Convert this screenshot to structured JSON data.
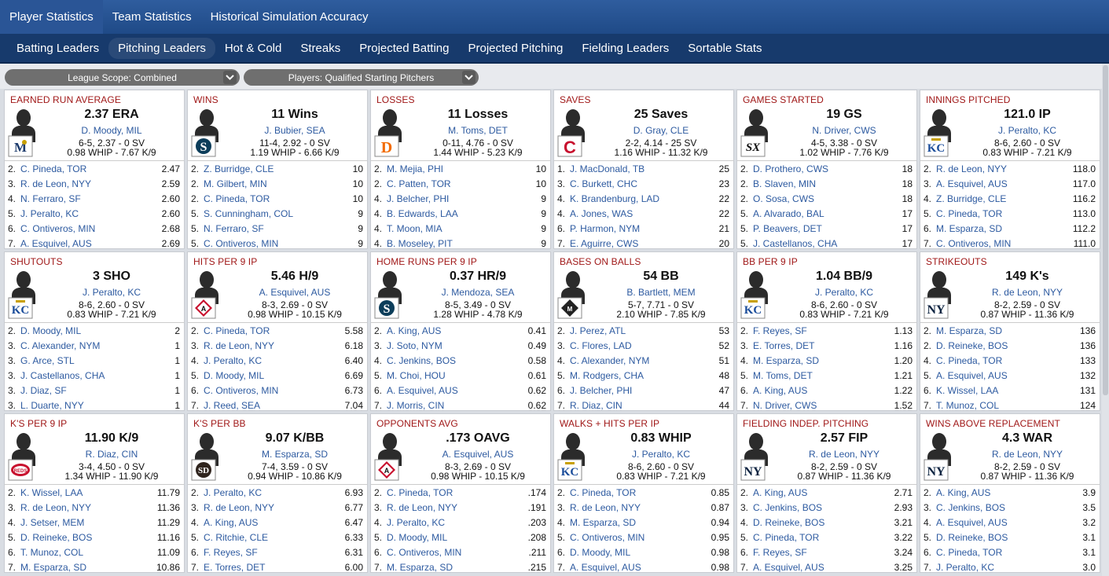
{
  "top_tabs": [
    {
      "label": "Player Statistics",
      "active": true
    },
    {
      "label": "Team Statistics",
      "active": false
    },
    {
      "label": "Historical Simulation Accuracy",
      "active": false
    }
  ],
  "sub_tabs": [
    {
      "label": "Batting Leaders",
      "active": false
    },
    {
      "label": "Pitching Leaders",
      "active": true
    },
    {
      "label": "Hot & Cold",
      "active": false
    },
    {
      "label": "Streaks",
      "active": false
    },
    {
      "label": "Projected Batting",
      "active": false
    },
    {
      "label": "Projected Pitching",
      "active": false
    },
    {
      "label": "Fielding Leaders",
      "active": false
    },
    {
      "label": "Sortable Stats",
      "active": false
    }
  ],
  "filters": {
    "scope": "League Scope: Combined",
    "players": "Players: Qualified Starting Pitchers"
  },
  "cards": [
    {
      "title": "EARNED RUN AVERAGE",
      "value": "2.37 ERA",
      "player": "D. Moody, MIL",
      "line1": "6-5, 2.37 - 0 SV",
      "line2": "0.98 WHIP - 7.67 K/9",
      "logo": "brewers-logo",
      "leaders": [
        [
          "2.",
          "C. Pineda, TOR",
          "2.47"
        ],
        [
          "3.",
          "R. de Leon, NYY",
          "2.59"
        ],
        [
          "4.",
          "N. Ferraro, SF",
          "2.60"
        ],
        [
          "5.",
          "J. Peralto, KC",
          "2.60"
        ],
        [
          "6.",
          "C. Ontiveros, MIN",
          "2.68"
        ],
        [
          "7.",
          "A. Esquivel, AUS",
          "2.69"
        ]
      ]
    },
    {
      "title": "WINS",
      "value": "11 Wins",
      "player": "J. Bubier, SEA",
      "line1": "11-4, 2.92 - 0 SV",
      "line2": "1.19 WHIP - 6.66 K/9",
      "logo": "mariners-logo",
      "leaders": [
        [
          "2.",
          "Z. Burridge, CLE",
          "10"
        ],
        [
          "2.",
          "M. Gilbert, MIN",
          "10"
        ],
        [
          "2.",
          "C. Pineda, TOR",
          "10"
        ],
        [
          "5.",
          "S. Cunningham, COL",
          "9"
        ],
        [
          "5.",
          "N. Ferraro, SF",
          "9"
        ],
        [
          "5.",
          "C. Ontiveros, MIN",
          "9"
        ]
      ]
    },
    {
      "title": "LOSSES",
      "value": "11 Losses",
      "player": "M. Toms, DET",
      "line1": "0-11, 4.76 - 0 SV",
      "line2": "1.44 WHIP - 5.23 K/9",
      "logo": "tigers-logo",
      "leaders": [
        [
          "2.",
          "M. Mejia, PHI",
          "10"
        ],
        [
          "2.",
          "C. Patten, TOR",
          "10"
        ],
        [
          "4.",
          "J. Belcher, PHI",
          "9"
        ],
        [
          "4.",
          "B. Edwards, LAA",
          "9"
        ],
        [
          "4.",
          "T. Moon, MIA",
          "9"
        ],
        [
          "4.",
          "B. Moseley, PIT",
          "9"
        ]
      ]
    },
    {
      "title": "SAVES",
      "value": "25 Saves",
      "player": "D. Gray, CLE",
      "line1": "2-2, 4.14 - 25 SV",
      "line2": "1.16 WHIP - 11.32 K/9",
      "logo": "guardians-logo",
      "leaders": [
        [
          "1.",
          "J. MacDonald, TB",
          "25"
        ],
        [
          "3.",
          "C. Burkett, CHC",
          "23"
        ],
        [
          "4.",
          "K. Brandenburg, LAD",
          "22"
        ],
        [
          "4.",
          "A. Jones, WAS",
          "22"
        ],
        [
          "6.",
          "P. Harmon, NYM",
          "21"
        ],
        [
          "7.",
          "E. Aguirre, CWS",
          "20"
        ]
      ]
    },
    {
      "title": "GAMES STARTED",
      "value": "19 GS",
      "player": "N. Driver, CWS",
      "line1": "4-5, 3.38 - 0 SV",
      "line2": "1.02 WHIP - 7.76 K/9",
      "logo": "whitesox-logo",
      "leaders": [
        [
          "2.",
          "D. Prothero, CWS",
          "18"
        ],
        [
          "2.",
          "B. Slaven, MIN",
          "18"
        ],
        [
          "2.",
          "O. Sosa, CWS",
          "18"
        ],
        [
          "5.",
          "A. Alvarado, BAL",
          "17"
        ],
        [
          "5.",
          "P. Beavers, DET",
          "17"
        ],
        [
          "5.",
          "J. Castellanos, CHA",
          "17"
        ]
      ]
    },
    {
      "title": "INNINGS PITCHED",
      "value": "121.0 IP",
      "player": "J. Peralto, KC",
      "line1": "8-6, 2.60 - 0 SV",
      "line2": "0.83 WHIP - 7.21 K/9",
      "logo": "royals-logo",
      "leaders": [
        [
          "2.",
          "R. de Leon, NYY",
          "118.0"
        ],
        [
          "3.",
          "A. Esquivel, AUS",
          "117.0"
        ],
        [
          "4.",
          "Z. Burridge, CLE",
          "116.2"
        ],
        [
          "5.",
          "C. Pineda, TOR",
          "113.0"
        ],
        [
          "6.",
          "M. Esparza, SD",
          "112.2"
        ],
        [
          "7.",
          "C. Ontiveros, MIN",
          "111.0"
        ]
      ]
    },
    {
      "title": "SHUTOUTS",
      "value": "3 SHO",
      "player": "J. Peralto, KC",
      "line1": "8-6, 2.60 - 0 SV",
      "line2": "0.83 WHIP - 7.21 K/9",
      "logo": "royals-logo",
      "leaders": [
        [
          "2.",
          "D. Moody, MIL",
          "2"
        ],
        [
          "3.",
          "C. Alexander, NYM",
          "1"
        ],
        [
          "3.",
          "G. Arce, STL",
          "1"
        ],
        [
          "3.",
          "J. Castellanos, CHA",
          "1"
        ],
        [
          "3.",
          "J. Diaz, SF",
          "1"
        ],
        [
          "3.",
          "L. Duarte, NYY",
          "1"
        ]
      ]
    },
    {
      "title": "HITS PER 9 IP",
      "value": "5.46 H/9",
      "player": "A. Esquivel, AUS",
      "line1": "8-3, 2.69 - 0 SV",
      "line2": "0.98 WHIP - 10.15 K/9",
      "logo": "aus-logo",
      "leaders": [
        [
          "2.",
          "C. Pineda, TOR",
          "5.58"
        ],
        [
          "3.",
          "R. de Leon, NYY",
          "6.18"
        ],
        [
          "4.",
          "J. Peralto, KC",
          "6.40"
        ],
        [
          "5.",
          "D. Moody, MIL",
          "6.69"
        ],
        [
          "6.",
          "C. Ontiveros, MIN",
          "6.73"
        ],
        [
          "7.",
          "J. Reed, SEA",
          "7.04"
        ]
      ]
    },
    {
      "title": "HOME RUNS PER 9 IP",
      "value": "0.37 HR/9",
      "player": "J. Mendoza, SEA",
      "line1": "8-5, 3.49 - 0 SV",
      "line2": "1.28 WHIP - 4.78 K/9",
      "logo": "mariners-logo",
      "leaders": [
        [
          "2.",
          "A. King, AUS",
          "0.41"
        ],
        [
          "3.",
          "J. Soto, NYM",
          "0.49"
        ],
        [
          "4.",
          "C. Jenkins, BOS",
          "0.58"
        ],
        [
          "5.",
          "M. Choi, HOU",
          "0.61"
        ],
        [
          "6.",
          "A. Esquivel, AUS",
          "0.62"
        ],
        [
          "7.",
          "J. Morris, CIN",
          "0.62"
        ]
      ]
    },
    {
      "title": "BASES ON BALLS",
      "value": "54 BB",
      "player": "B. Bartlett, MEM",
      "line1": "5-7, 7.71 - 0 SV",
      "line2": "2.10 WHIP - 7.85 K/9",
      "logo": "mem-logo",
      "leaders": [
        [
          "2.",
          "J. Perez, ATL",
          "53"
        ],
        [
          "3.",
          "C. Flores, LAD",
          "52"
        ],
        [
          "4.",
          "C. Alexander, NYM",
          "51"
        ],
        [
          "5.",
          "M. Rodgers, CHA",
          "48"
        ],
        [
          "6.",
          "J. Belcher, PHI",
          "47"
        ],
        [
          "7.",
          "R. Diaz, CIN",
          "44"
        ]
      ]
    },
    {
      "title": "BB PER 9 IP",
      "value": "1.04 BB/9",
      "player": "J. Peralto, KC",
      "line1": "8-6, 2.60 - 0 SV",
      "line2": "0.83 WHIP - 7.21 K/9",
      "logo": "royals-logo",
      "leaders": [
        [
          "2.",
          "F. Reyes, SF",
          "1.13"
        ],
        [
          "3.",
          "E. Torres, DET",
          "1.16"
        ],
        [
          "4.",
          "M. Esparza, SD",
          "1.20"
        ],
        [
          "5.",
          "M. Toms, DET",
          "1.21"
        ],
        [
          "6.",
          "A. King, AUS",
          "1.22"
        ],
        [
          "7.",
          "N. Driver, CWS",
          "1.52"
        ]
      ]
    },
    {
      "title": "STRIKEOUTS",
      "value": "149 K's",
      "player": "R. de Leon, NYY",
      "line1": "8-2, 2.59 - 0 SV",
      "line2": "0.87 WHIP - 11.36 K/9",
      "logo": "yankees-logo",
      "leaders": [
        [
          "2.",
          "M. Esparza, SD",
          "136"
        ],
        [
          "2.",
          "D. Reineke, BOS",
          "136"
        ],
        [
          "4.",
          "C. Pineda, TOR",
          "133"
        ],
        [
          "5.",
          "A. Esquivel, AUS",
          "132"
        ],
        [
          "6.",
          "K. Wissel, LAA",
          "131"
        ],
        [
          "7.",
          "T. Munoz, COL",
          "124"
        ]
      ]
    },
    {
      "title": "K'S PER 9 IP",
      "value": "11.90 K/9",
      "player": "R. Diaz, CIN",
      "line1": "3-4, 4.50 - 0 SV",
      "line2": "1.34 WHIP - 11.90 K/9",
      "logo": "reds-logo",
      "leaders": [
        [
          "2.",
          "K. Wissel, LAA",
          "11.79"
        ],
        [
          "3.",
          "R. de Leon, NYY",
          "11.36"
        ],
        [
          "4.",
          "J. Setser, MEM",
          "11.29"
        ],
        [
          "5.",
          "D. Reineke, BOS",
          "11.16"
        ],
        [
          "6.",
          "T. Munoz, COL",
          "11.09"
        ],
        [
          "7.",
          "M. Esparza, SD",
          "10.86"
        ]
      ]
    },
    {
      "title": "K'S PER BB",
      "value": "9.07 K/BB",
      "player": "M. Esparza, SD",
      "line1": "7-4, 3.59 - 0 SV",
      "line2": "0.94 WHIP - 10.86 K/9",
      "logo": "padres-logo",
      "leaders": [
        [
          "2.",
          "J. Peralto, KC",
          "6.93"
        ],
        [
          "3.",
          "R. de Leon, NYY",
          "6.77"
        ],
        [
          "4.",
          "A. King, AUS",
          "6.47"
        ],
        [
          "5.",
          "C. Ritchie, CLE",
          "6.33"
        ],
        [
          "6.",
          "F. Reyes, SF",
          "6.31"
        ],
        [
          "7.",
          "E. Torres, DET",
          "6.00"
        ]
      ]
    },
    {
      "title": "OPPONENTS AVG",
      "value": ".173 OAVG",
      "player": "A. Esquivel, AUS",
      "line1": "8-3, 2.69 - 0 SV",
      "line2": "0.98 WHIP - 10.15 K/9",
      "logo": "aus-logo",
      "leaders": [
        [
          "2.",
          "C. Pineda, TOR",
          ".174"
        ],
        [
          "3.",
          "R. de Leon, NYY",
          ".191"
        ],
        [
          "4.",
          "J. Peralto, KC",
          ".203"
        ],
        [
          "5.",
          "D. Moody, MIL",
          ".208"
        ],
        [
          "6.",
          "C. Ontiveros, MIN",
          ".211"
        ],
        [
          "7.",
          "M. Esparza, SD",
          ".215"
        ]
      ]
    },
    {
      "title": "WALKS + HITS PER IP",
      "value": "0.83 WHIP",
      "player": "J. Peralto, KC",
      "line1": "8-6, 2.60 - 0 SV",
      "line2": "0.83 WHIP - 7.21 K/9",
      "logo": "royals-logo",
      "leaders": [
        [
          "2.",
          "C. Pineda, TOR",
          "0.85"
        ],
        [
          "3.",
          "R. de Leon, NYY",
          "0.87"
        ],
        [
          "4.",
          "M. Esparza, SD",
          "0.94"
        ],
        [
          "5.",
          "C. Ontiveros, MIN",
          "0.95"
        ],
        [
          "6.",
          "D. Moody, MIL",
          "0.98"
        ],
        [
          "7.",
          "A. Esquivel, AUS",
          "0.98"
        ]
      ]
    },
    {
      "title": "FIELDING INDEP. PITCHING",
      "value": "2.57 FIP",
      "player": "R. de Leon, NYY",
      "line1": "8-2, 2.59 - 0 SV",
      "line2": "0.87 WHIP - 11.36 K/9",
      "logo": "yankees-logo",
      "leaders": [
        [
          "2.",
          "A. King, AUS",
          "2.71"
        ],
        [
          "3.",
          "C. Jenkins, BOS",
          "2.93"
        ],
        [
          "4.",
          "D. Reineke, BOS",
          "3.21"
        ],
        [
          "5.",
          "C. Pineda, TOR",
          "3.22"
        ],
        [
          "6.",
          "F. Reyes, SF",
          "3.24"
        ],
        [
          "7.",
          "A. Esquivel, AUS",
          "3.25"
        ]
      ]
    },
    {
      "title": "WINS ABOVE REPLACEMENT",
      "value": "4.3 WAR",
      "player": "R. de Leon, NYY",
      "line1": "8-2, 2.59 - 0 SV",
      "line2": "0.87 WHIP - 11.36 K/9",
      "logo": "yankees-logo",
      "leaders": [
        [
          "2.",
          "A. King, AUS",
          "3.9"
        ],
        [
          "3.",
          "C. Jenkins, BOS",
          "3.5"
        ],
        [
          "4.",
          "A. Esquivel, AUS",
          "3.2"
        ],
        [
          "5.",
          "D. Reineke, BOS",
          "3.1"
        ],
        [
          "6.",
          "C. Pineda, TOR",
          "3.1"
        ],
        [
          "7.",
          "J. Peralto, KC",
          "3.0"
        ]
      ]
    }
  ],
  "colors": {
    "title_red": "#a01818",
    "link_blue": "#2d5aa0",
    "nav_blue": "#2f5d9e",
    "subnav_blue": "#173a6c"
  }
}
